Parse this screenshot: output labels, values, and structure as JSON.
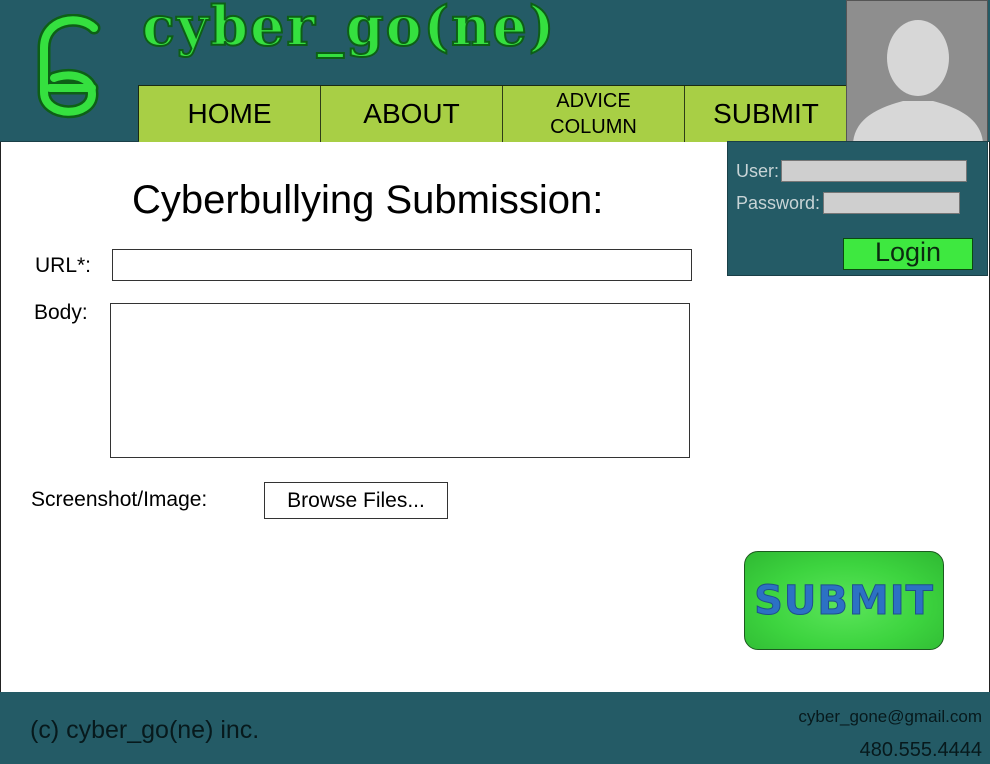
{
  "header": {
    "brand": "cyber_go(ne)",
    "logo_icon": "cg-monogram-icon",
    "avatar_icon": "user-silhouette-icon",
    "nav": {
      "home": "HOME",
      "about": "ABOUT",
      "advice": "ADVICE\nCOLUMN",
      "submit": "SUBMIT"
    }
  },
  "login": {
    "user_label": "User:",
    "password_label": "Password:",
    "button": "Login"
  },
  "form": {
    "title": "Cyberbullying Submission:",
    "url_label": "URL*:",
    "body_label": "Body:",
    "screenshot_label": "Screenshot/Image:",
    "browse_button": "Browse Files...",
    "submit_button": "SUBMIT"
  },
  "footer": {
    "copyright": "(c) cyber_go(ne) inc.",
    "email": "cyber_gone@gmail.com",
    "phone": "480.555.4444"
  },
  "colors": {
    "header_bg": "#245b66",
    "nav_bg": "#a8cf45",
    "brand_green": "#35e03f",
    "login_button": "#3ee840",
    "submit_text": "#2c71c4"
  }
}
